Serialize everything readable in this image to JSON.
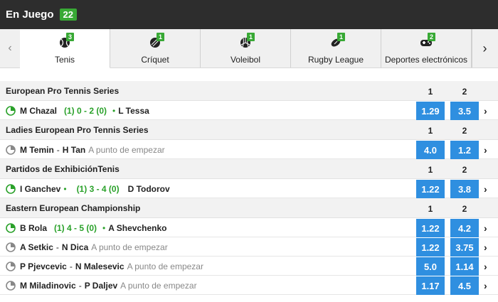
{
  "header": {
    "title": "En Juego",
    "count": "22"
  },
  "tabs": [
    {
      "label": "Tenis",
      "badge": "3",
      "icon": "tennis-ball-icon",
      "active": true
    },
    {
      "label": "Críquet",
      "badge": "1",
      "icon": "cricket-ball-icon",
      "active": false
    },
    {
      "label": "Voleibol",
      "badge": "1",
      "icon": "volleyball-icon",
      "active": false
    },
    {
      "label": "Rugby League",
      "badge": "1",
      "icon": "rugby-ball-icon",
      "active": false
    },
    {
      "label": "Deportes electrónicos",
      "badge": "2",
      "icon": "gamepad-icon",
      "active": false
    }
  ],
  "nav": {
    "prev": "‹",
    "next": "›"
  },
  "colors": {
    "accent_green": "#38a935",
    "odd_blue": "#2f8fe0",
    "topbar": "#2d2d2d"
  },
  "sections": [
    {
      "title": "European Pro Tennis Series",
      "col1": "1",
      "col2": "2",
      "matches": [
        {
          "live": true,
          "home": "M Chazal",
          "score": "(1) 0 - 2 (0)",
          "away": "L Tessa",
          "status": "",
          "odd1": "1.29",
          "odd2": "3.5",
          "serve": "away"
        }
      ]
    },
    {
      "title": "Ladies European Pro Tennis Series",
      "col1": "1",
      "col2": "2",
      "matches": [
        {
          "live": false,
          "home": "M Temin",
          "away": "H Tan",
          "score": "",
          "status": "A punto de empezar",
          "odd1": "4.0",
          "odd2": "1.2"
        }
      ]
    },
    {
      "title": "Partidos de ExhibiciónTenis",
      "col1": "1",
      "col2": "2",
      "matches": [
        {
          "live": true,
          "home": "I Ganchev",
          "score": "(1) 3 - 4 (0)",
          "away": "D Todorov",
          "status": "",
          "odd1": "1.22",
          "odd2": "3.8",
          "serve": "home"
        }
      ]
    },
    {
      "title": "Eastern European Championship",
      "col1": "1",
      "col2": "2",
      "matches": [
        {
          "live": true,
          "home": "B Rola",
          "score": "(1) 4 - 5 (0)",
          "away": "A Shevchenko",
          "status": "",
          "odd1": "1.22",
          "odd2": "4.2",
          "serve": "away"
        },
        {
          "live": false,
          "home": "A Setkic",
          "away": "N Dica",
          "score": "",
          "status": "A punto de empezar",
          "odd1": "1.22",
          "odd2": "3.75"
        },
        {
          "live": false,
          "home": "P Pjevcevic",
          "away": "N Malesevic",
          "score": "",
          "status": "A punto de empezar",
          "odd1": "5.0",
          "odd2": "1.14"
        },
        {
          "live": false,
          "home": "M Miladinovic",
          "away": "P Daljev",
          "score": "",
          "status": "A punto de empezar",
          "odd1": "1.17",
          "odd2": "4.5"
        }
      ]
    }
  ]
}
